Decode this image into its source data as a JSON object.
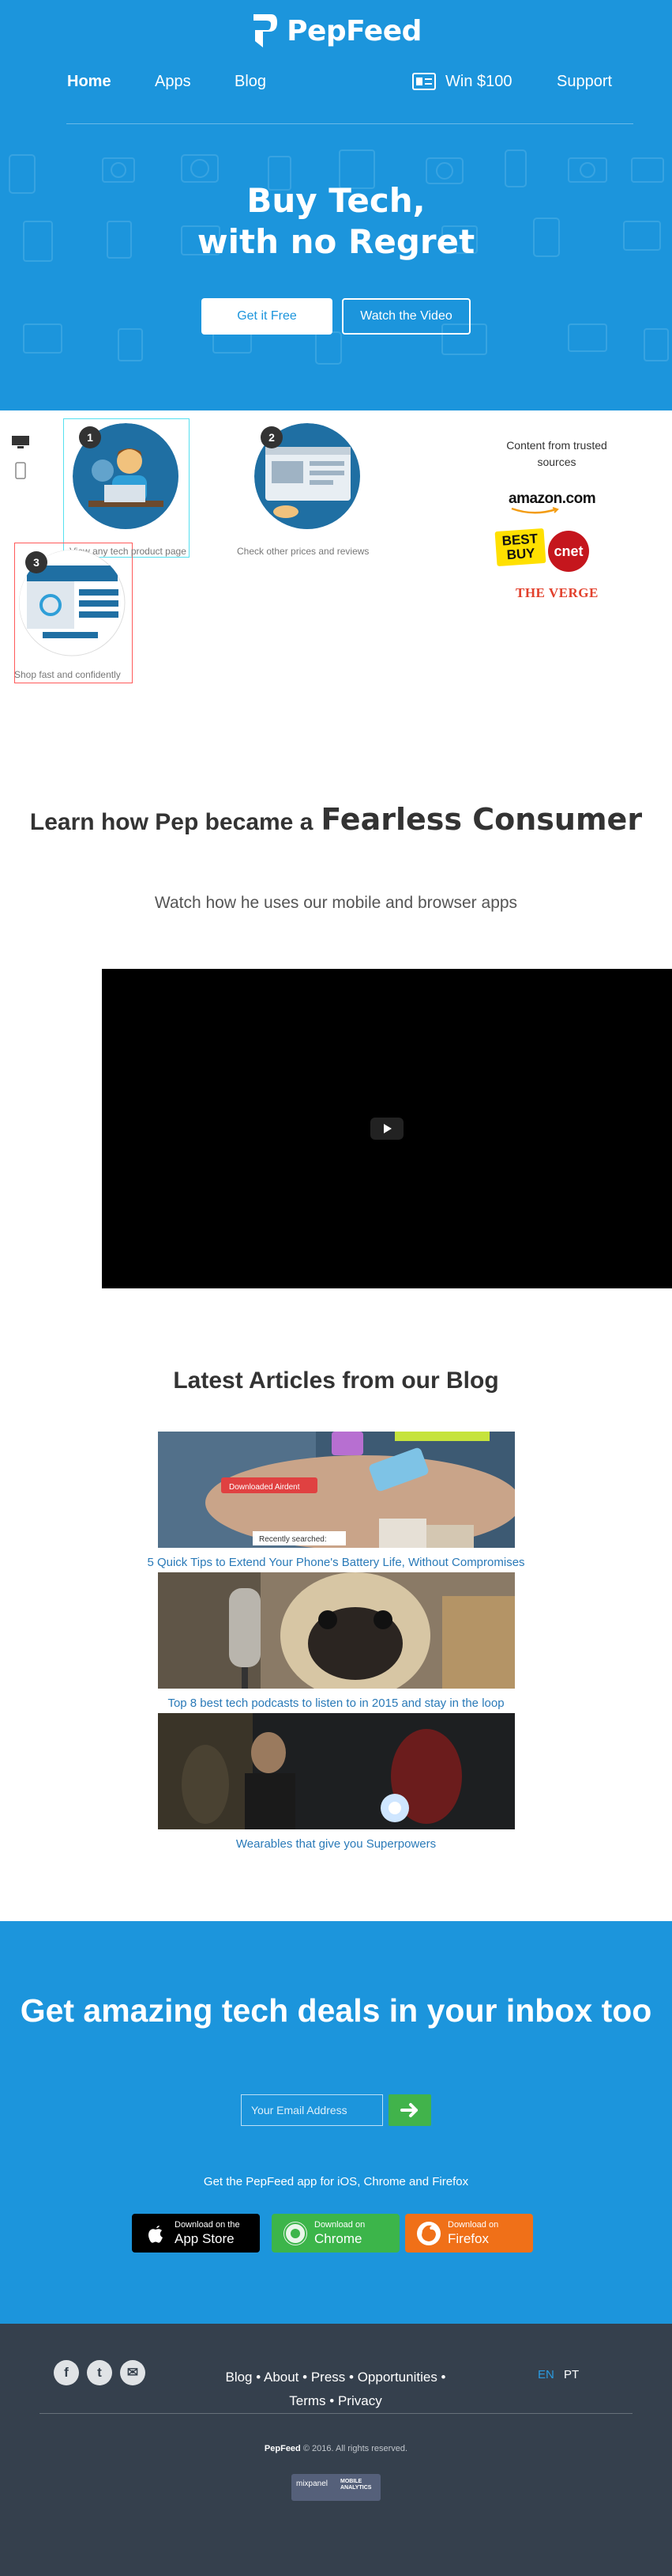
{
  "brand": {
    "name": "PepFeed"
  },
  "nav": {
    "items": [
      {
        "label": "Home",
        "active": true
      },
      {
        "label": "Apps"
      },
      {
        "label": "Blog"
      }
    ],
    "win_label": "Win $100",
    "support_label": "Support"
  },
  "hero": {
    "title_line1": "Buy Tech,",
    "title_line2": "with no Regret",
    "cta_primary": "Get it Free",
    "cta_secondary": "Watch the Video"
  },
  "steps": [
    {
      "number": "1",
      "label": "View any tech product page"
    },
    {
      "number": "2",
      "label": "Check other prices and reviews"
    },
    {
      "number": "3",
      "label": "Shop fast and confidently"
    }
  ],
  "trusted": {
    "heading": "Content from trusted sources",
    "sources": [
      "amazon.com",
      "BEST BUY",
      "cnet",
      "THE VERGE"
    ]
  },
  "pep": {
    "heading_prefix": "Learn how Pep became a",
    "heading_bold": "Fearless Consumer",
    "subheading": "Watch how he uses our mobile and browser apps"
  },
  "blog": {
    "heading": "Latest Articles from our Blog",
    "articles": [
      {
        "title": "5 Quick Tips to Extend Your Phone's Battery Life, Without Compromises",
        "overlay_1": "Downloaded Airdent",
        "overlay_2": "Recently searched:"
      },
      {
        "title": "Top 8 best tech podcasts to listen to in 2015 and stay in the loop"
      },
      {
        "title": "Wearables that give you Superpowers"
      }
    ]
  },
  "newsletter": {
    "heading": "Get amazing tech deals in your inbox too",
    "email_placeholder": "Your Email Address",
    "apps_line": "Get the PepFeed app for iOS, Chrome and Firefox",
    "stores": [
      {
        "small": "Download on the",
        "big": "App Store",
        "color": "#000000"
      },
      {
        "small": "Download on",
        "big": "Chrome",
        "color": "#3cb54a"
      },
      {
        "small": "Download on",
        "big": "Firefox",
        "color": "#f07018"
      }
    ]
  },
  "footer": {
    "social": [
      "f",
      "t",
      "✉"
    ],
    "links": [
      "Blog",
      "About",
      "Press",
      "Opportunities",
      "Terms",
      "Privacy"
    ],
    "languages": [
      "EN",
      "PT"
    ],
    "copyright_brand": "PepFeed",
    "copyright_rest": "© 2016. All rights reserved.",
    "mixpanel_1": "mixpanel",
    "mixpanel_2": "MOBILE ANALYTICS"
  },
  "colors": {
    "brand_blue": "#1c95dc",
    "footer_bg": "#35404d",
    "link_blue": "#2a7ab8",
    "go_green": "#41b34b"
  }
}
